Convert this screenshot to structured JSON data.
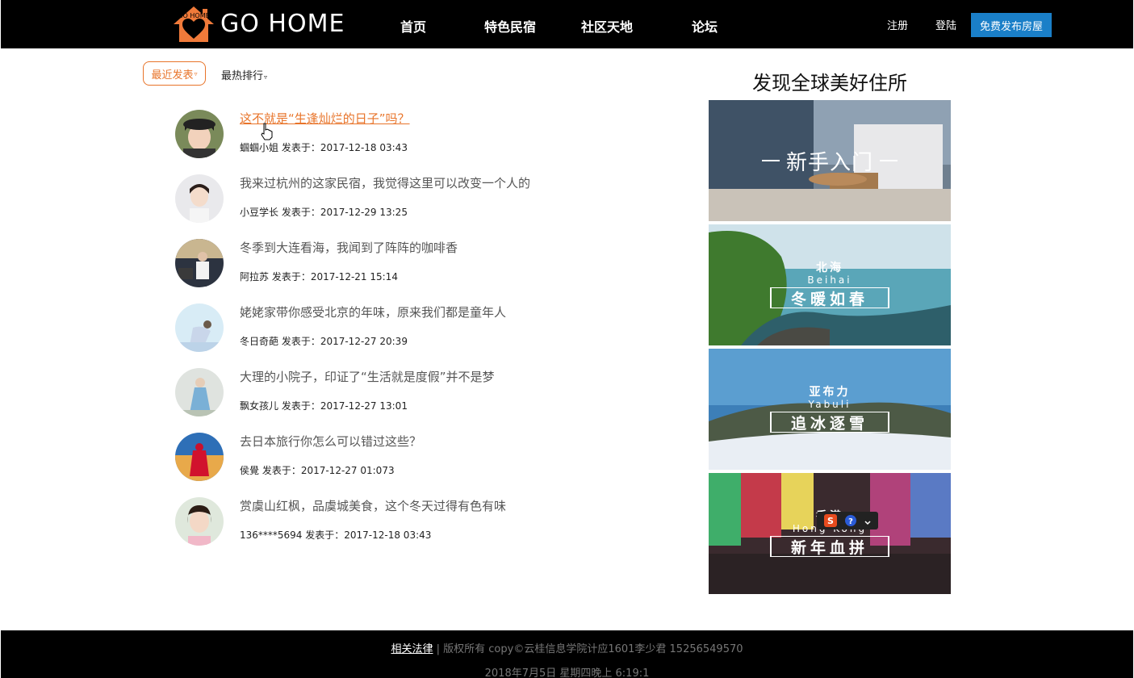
{
  "header": {
    "logo_text": "GO HOME",
    "logo_badge": "GO HOME",
    "nav": [
      {
        "label": "首页"
      },
      {
        "label": "特色民宿"
      },
      {
        "label": "社区天地"
      },
      {
        "label": "论坛"
      }
    ],
    "register_label": "注册",
    "login_label": "登陆",
    "publish_label": "免费发布房屋"
  },
  "sort": {
    "recent_label": "最近发表",
    "hot_label": "最热排行",
    "caret": "▿"
  },
  "posts": [
    {
      "title": "这不就是“生逢灿烂的日子”吗？",
      "meta": "蝈蝈小姐 发表于：2017-12-18 03:43",
      "active": true
    },
    {
      "title": "我来过杭州的这家民宿，我觉得这里可以改变一个人的",
      "meta": "小豆学长 发表于：2017-12-29 13:25"
    },
    {
      "title": "冬季到大连看海，我闻到了阵阵的咖啡香",
      "meta": "阿拉苏 发表于：2017-12-21 15:14"
    },
    {
      "title": "姥姥家带你感受北京的年味，原来我们都是童年人",
      "meta": "冬日奇葩 发表于：2017-12-27 20:39"
    },
    {
      "title": "大理的小院子，印证了“生活就是度假”并不是梦",
      "meta": "飘女孩儿 发表于：2017-12-27 13:01"
    },
    {
      "title": "去日本旅行你怎么可以错过这些？",
      "meta": "侯覺 发表于：2017-12-27 01:073"
    },
    {
      "title": "赏虞山红枫，品虞城美食，这个冬天过得有色有味",
      "meta": "136****5694 发表于：2017-12-18 03:43"
    }
  ],
  "discover": {
    "title": "发现全球美好住所",
    "banners": [
      {
        "main": "新手入门"
      },
      {
        "sub": "北海",
        "sub_en": "Beihai",
        "main": "冬暖如春"
      },
      {
        "sub": "亚布力",
        "sub_en": "Yabuli",
        "main": "追冰逐雪"
      },
      {
        "sub": "香港",
        "sub_en": "Hong Kong",
        "main": "新年血拼"
      }
    ]
  },
  "footer": {
    "link_label": "相关法律",
    "separator": "|",
    "copyright": "版权所有 copy©云桂信息学院计应1601李少君 15256549570",
    "datetime": "2018年7月5日   星期四晚上  6:19:1"
  },
  "colors": {
    "accent": "#e8742a",
    "publish_button": "#1a7fc8",
    "header_bg": "#000000"
  }
}
